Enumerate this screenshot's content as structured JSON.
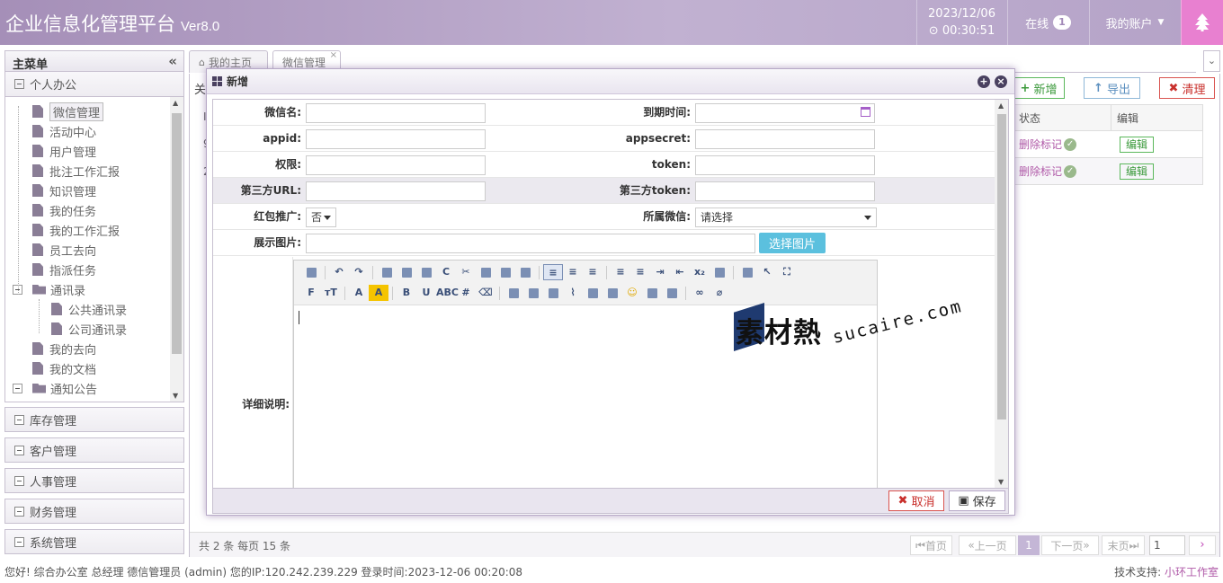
{
  "header": {
    "title": "企业信息化管理平台",
    "version": "Ver8.0",
    "date": "2023/12/06",
    "time": "00:30:51",
    "clock_icon": "clock-icon",
    "online_label": "在线",
    "online_count": "1",
    "account_label": "我的账户",
    "tree_icon": "tree-icon"
  },
  "sidebar": {
    "title": "主菜单",
    "sections_top": [
      "个人办公"
    ],
    "tree": [
      {
        "label": "微信管理",
        "kind": "page",
        "level": 1
      },
      {
        "label": "活动中心",
        "kind": "page",
        "level": 1
      },
      {
        "label": "用户管理",
        "kind": "page",
        "level": 1
      },
      {
        "label": "批注工作汇报",
        "kind": "page",
        "level": 1
      },
      {
        "label": "知识管理",
        "kind": "page",
        "level": 1
      },
      {
        "label": "我的任务",
        "kind": "page",
        "level": 1
      },
      {
        "label": "我的工作汇报",
        "kind": "page",
        "level": 1
      },
      {
        "label": "员工去向",
        "kind": "page",
        "level": 1
      },
      {
        "label": "指派任务",
        "kind": "page",
        "level": 1
      },
      {
        "label": "通讯录",
        "kind": "folder",
        "level": 1
      },
      {
        "label": "公共通讯录",
        "kind": "page",
        "level": 2
      },
      {
        "label": "公司通讯录",
        "kind": "page",
        "level": 2
      },
      {
        "label": "我的去向",
        "kind": "page",
        "level": 1
      },
      {
        "label": "我的文档",
        "kind": "page",
        "level": 1
      },
      {
        "label": "通知公告",
        "kind": "folder",
        "level": 1
      }
    ],
    "sections_bottom": [
      "库存管理",
      "客户管理",
      "人事管理",
      "财务管理",
      "系统管理"
    ]
  },
  "tabs": {
    "home": "我的主页",
    "wechat": "微信管理"
  },
  "toolbar": {
    "left_stub": "关",
    "add": "新增",
    "export": "导出",
    "clear": "清理"
  },
  "grid": {
    "columns": [
      "状态",
      "编辑"
    ],
    "rows": [
      {
        "status": "删除标记",
        "edit": "编辑",
        "left": "9"
      },
      {
        "status": "删除标记",
        "edit": "编辑",
        "left": "2"
      }
    ],
    "left_header_stub": "I"
  },
  "pager": {
    "info": "共 2 条 每页 15 条",
    "first": "首页",
    "prev": "上一页",
    "current": "1",
    "next": "下一页",
    "last": "末页",
    "page_input": "1",
    "go": "›"
  },
  "footer": {
    "left": "您好! 综合办公室 总经理 德信管理员 (admin) 您的IP:120.242.239.229 登录时间:2023-12-06 00:20:08",
    "support_label": "技术支持:",
    "support_link": "小环工作室"
  },
  "dialog": {
    "title": "新增",
    "fields": {
      "wx_name": "微信名:",
      "expire": "到期时间:",
      "appid": "appid:",
      "appsecret": "appsecret:",
      "perm": "权限:",
      "token": "token:",
      "third_url": "第三方URL:",
      "third_token": "第三方token:",
      "redpack": "红包推广:",
      "redpack_value": "否",
      "belong_wx": "所属微信:",
      "belong_wx_value": "请选择",
      "image": "展示图片:",
      "pick_image": "选择图片",
      "detail": "详细说明:"
    },
    "cancel": "取消",
    "save": "保存"
  },
  "editor": {
    "row1": [
      "source-icon",
      "undo-icon",
      "redo-icon",
      "preview-icon",
      "print-icon",
      "template-icon",
      "code-icon",
      "cut-icon",
      "copy-icon",
      "paste-icon",
      "paste-text-icon",
      "align-left-icon",
      "align-center-icon",
      "align-right-icon",
      "ordered-list-icon",
      "unordered-list-icon",
      "indent-icon",
      "outdent-icon",
      "subscript-icon",
      "clear-format-icon",
      "brush-icon",
      "select-all-icon",
      "fullscreen-icon"
    ],
    "row2": [
      "font-family-icon",
      "font-size-icon",
      "font-color-icon",
      "highlight-icon",
      "bold-icon",
      "underline-icon",
      "strikethrough-icon",
      "hr-icon",
      "eraser-icon",
      "image-icon",
      "multi-image-icon",
      "flash-icon",
      "attachment-icon",
      "table-icon",
      "insert-line-icon",
      "emoticon-icon",
      "picture-icon",
      "page-break-icon",
      "link-icon",
      "unlink-icon"
    ]
  },
  "watermark": {
    "cn": "素材熱",
    "en": "sucaire.com"
  },
  "colors": {
    "header_bg": "#b4a2c7",
    "accent": "#c04ab8",
    "tree_btn": "#e880d0",
    "add_green": "#5cb85c",
    "clear_red": "#d9534f",
    "pick_blue": "#5bc0de"
  }
}
